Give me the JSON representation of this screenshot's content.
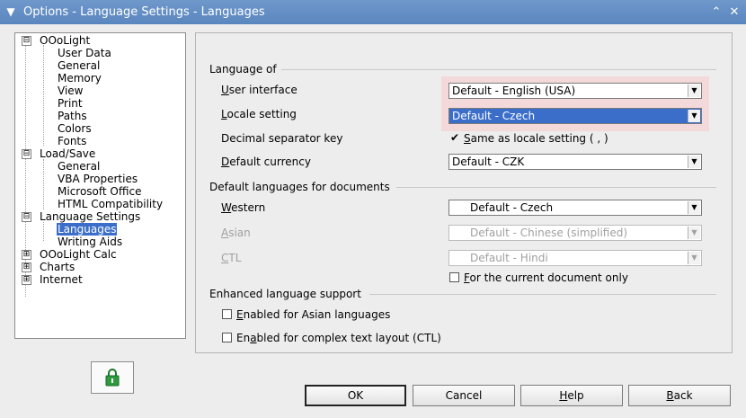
{
  "window": {
    "title": "Options - Language Settings - Languages",
    "menu_icon": "chevron-down-icon",
    "minimize_icon": "minimize-icon",
    "close_icon": "close-icon"
  },
  "tree": {
    "items": [
      {
        "label": "OOoLight",
        "expander": "⊟"
      },
      {
        "label": "User Data"
      },
      {
        "label": "General"
      },
      {
        "label": "Memory"
      },
      {
        "label": "View"
      },
      {
        "label": "Print"
      },
      {
        "label": "Paths"
      },
      {
        "label": "Colors"
      },
      {
        "label": "Fonts"
      },
      {
        "label": "Load/Save",
        "expander": "⊟"
      },
      {
        "label": "General"
      },
      {
        "label": "VBA Properties"
      },
      {
        "label": "Microsoft Office"
      },
      {
        "label": "HTML Compatibility"
      },
      {
        "label": "Language Settings",
        "expander": "⊟"
      },
      {
        "label": "Languages"
      },
      {
        "label": "Writing Aids"
      },
      {
        "label": "OOoLight Calc",
        "expander": "⊞"
      },
      {
        "label": "Charts",
        "expander": "⊞"
      },
      {
        "label": "Internet",
        "expander": "⊞"
      }
    ]
  },
  "lock_icon": "lock-icon",
  "language_of": {
    "heading": "Language of",
    "user_interface": {
      "label_pre": "",
      "label_u": "U",
      "label_post": "ser interface",
      "value": "Default - English (USA)"
    },
    "locale_setting": {
      "label_pre": "",
      "label_u": "L",
      "label_post": "ocale setting",
      "value": "Default - Czech"
    },
    "decimal_separator": {
      "label": "Decimal separator key",
      "checkbox_pre": "",
      "checkbox_u": "S",
      "checkbox_post": "ame as locale setting ( , )",
      "checked": true,
      "check_glyph": "✔"
    },
    "default_currency": {
      "label_pre": "",
      "label_u": "D",
      "label_post": "efault currency",
      "value": "Default - CZK"
    }
  },
  "default_languages": {
    "heading": "Default languages for documents",
    "western": {
      "label_pre": "",
      "label_u": "W",
      "label_post": "estern",
      "value": "Default - Czech"
    },
    "asian": {
      "label_pre": "",
      "label_u": "A",
      "label_post": "sian",
      "value": "Default - Chinese (simplified)"
    },
    "ctl": {
      "label_pre": "",
      "label_u": "C",
      "label_post": "TL",
      "value": "Default - Hindi"
    },
    "current_doc": {
      "label_pre": "",
      "label_u": "F",
      "label_post": "or the current document only",
      "checked": false
    }
  },
  "enhanced": {
    "heading": "Enhanced language support",
    "asian": {
      "label_pre": "",
      "label_u": "E",
      "label_post": "nabled for Asian languages",
      "checked": false
    },
    "ctl": {
      "label_pre": "En",
      "label_u": "a",
      "label_post": "bled for complex text layout (CTL)",
      "checked": false
    }
  },
  "buttons": {
    "ok": "OK",
    "cancel": "Cancel",
    "help_u": "H",
    "help_post": "elp",
    "back_u": "B",
    "back_post": "ack"
  },
  "dropdown_glyph": "▼"
}
